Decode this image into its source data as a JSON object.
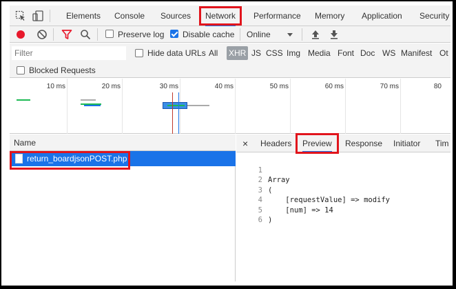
{
  "devtools_tabs": [
    "Elements",
    "Console",
    "Sources",
    "Network",
    "Performance",
    "Memory",
    "Application",
    "Security"
  ],
  "active_tab": "Network",
  "toolbar": {
    "preserve_log_label": "Preserve log",
    "preserve_log_checked": false,
    "disable_cache_label": "Disable cache",
    "disable_cache_checked": true,
    "throttle_value": "Online"
  },
  "filter": {
    "placeholder": "Filter",
    "hide_data_urls_label": "Hide data URLs",
    "types": [
      "All",
      "XHR",
      "JS",
      "CSS",
      "Img",
      "Media",
      "Font",
      "Doc",
      "WS",
      "Manifest",
      "Ot"
    ],
    "selected_type": "XHR",
    "blocked_requests_label": "Blocked Requests"
  },
  "timeline": {
    "tick_labels": [
      "10 ms",
      "20 ms",
      "30 ms",
      "40 ms",
      "50 ms",
      "60 ms",
      "70 ms",
      "80"
    ]
  },
  "requests": {
    "header": "Name",
    "rows": [
      "return_boardjsonPOST.php"
    ]
  },
  "detail": {
    "close_glyph": "×",
    "tabs": [
      "Headers",
      "Preview",
      "Response",
      "Initiator",
      "Tim"
    ],
    "active_tab": "Preview",
    "preview_lines": [
      {
        "n": "1",
        "text": "Array"
      },
      {
        "n": "2",
        "text": "("
      },
      {
        "n": "3",
        "text": "    [requestValue] => modify"
      },
      {
        "n": "4",
        "text": "    [num] => 14"
      },
      {
        "n": "5",
        "text": ")"
      },
      {
        "n": "6",
        "text": ""
      }
    ]
  },
  "colors": {
    "highlight_red": "#e1141c",
    "selection_blue": "#1a73e8",
    "record_red": "#e8192c"
  }
}
